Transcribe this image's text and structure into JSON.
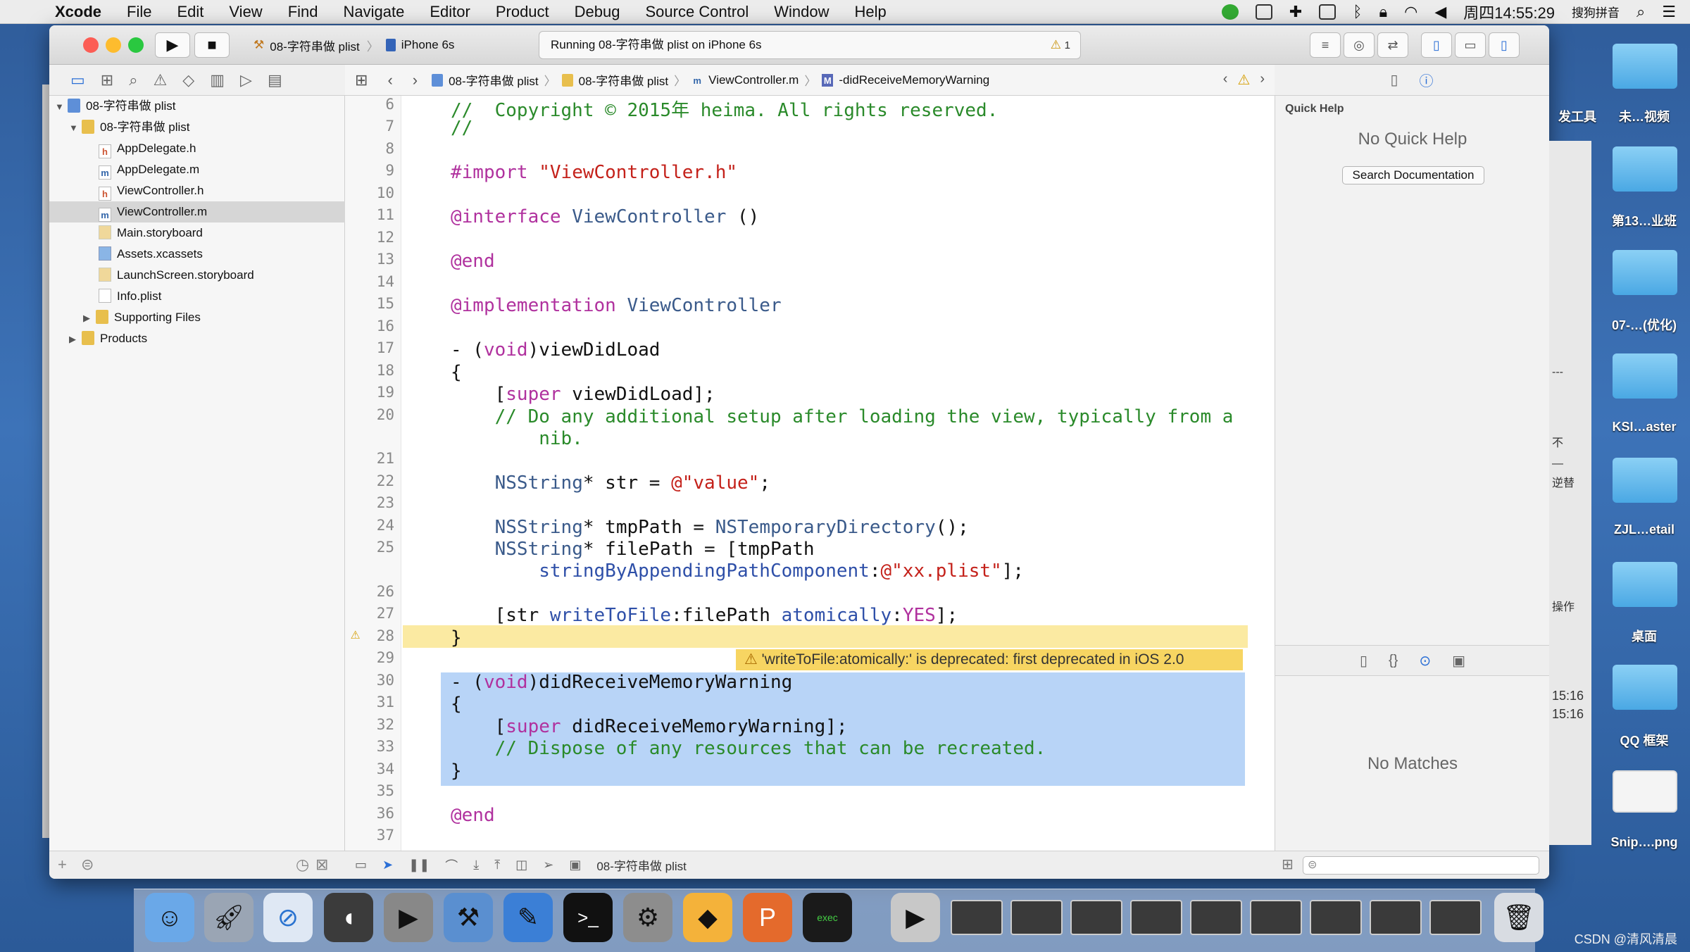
{
  "menubar": {
    "app": "Xcode",
    "items": [
      "File",
      "Edit",
      "View",
      "Find",
      "Navigate",
      "Editor",
      "Product",
      "Debug",
      "Source Control",
      "Window",
      "Help"
    ],
    "clock": "周四14:55:29",
    "ime": "搜狗拼音"
  },
  "toolbar": {
    "scheme": "08-字符串做 plist",
    "device": "iPhone 6s",
    "activity": "Running 08-字符串做 plist on iPhone 6s",
    "warning_count": "1"
  },
  "navigator": {
    "items": [
      {
        "label": "08-字符串做 plist",
        "kind": "proj",
        "icon": "project-icon"
      },
      {
        "label": "08-字符串做 plist",
        "kind": "folder",
        "icon": "folder-icon"
      },
      {
        "label": "AppDelegate.h",
        "kind": "h",
        "icon": "header-file-icon"
      },
      {
        "label": "AppDelegate.m",
        "kind": "m",
        "icon": "source-file-icon"
      },
      {
        "label": "ViewController.h",
        "kind": "h",
        "icon": "header-file-icon"
      },
      {
        "label": "ViewController.m",
        "kind": "m",
        "icon": "source-file-icon"
      },
      {
        "label": "Main.storyboard",
        "kind": "sb",
        "icon": "storyboard-icon"
      },
      {
        "label": "Assets.xcassets",
        "kind": "xc",
        "icon": "assets-icon"
      },
      {
        "label": "LaunchScreen.storyboard",
        "kind": "sb",
        "icon": "storyboard-icon"
      },
      {
        "label": "Info.plist",
        "kind": "pl",
        "icon": "plist-icon"
      },
      {
        "label": "Supporting Files",
        "kind": "folder",
        "icon": "folder-icon"
      },
      {
        "label": "Products",
        "kind": "folder",
        "icon": "folder-icon"
      }
    ]
  },
  "jumpbar": {
    "crumbs": [
      "08-字符串做 plist",
      "08-字符串做 plist",
      "ViewController.m",
      "-didReceiveMemoryWarning"
    ]
  },
  "editor": {
    "lines": [
      {
        "n": "6",
        "t": "//  Copyright © 2015年 heima. All rights reserved."
      },
      {
        "n": "7",
        "t": "//"
      },
      {
        "n": "8",
        "t": ""
      },
      {
        "n": "9",
        "t": "#import \"ViewController.h\""
      },
      {
        "n": "10",
        "t": ""
      },
      {
        "n": "11",
        "t": "@interface ViewController ()"
      },
      {
        "n": "12",
        "t": ""
      },
      {
        "n": "13",
        "t": "@end"
      },
      {
        "n": "14",
        "t": ""
      },
      {
        "n": "15",
        "t": "@implementation ViewController"
      },
      {
        "n": "16",
        "t": ""
      },
      {
        "n": "17",
        "t": "- (void)viewDidLoad"
      },
      {
        "n": "18",
        "t": "{"
      },
      {
        "n": "19",
        "t": "    [super viewDidLoad];"
      },
      {
        "n": "20",
        "t": "    // Do any additional setup after loading the view, typically from a"
      },
      {
        "n": "",
        "t": "        nib."
      },
      {
        "n": "21",
        "t": ""
      },
      {
        "n": "22",
        "t": "    NSString* str = @\"value\";"
      },
      {
        "n": "23",
        "t": ""
      },
      {
        "n": "24",
        "t": "    NSString* tmpPath = NSTemporaryDirectory();"
      },
      {
        "n": "25",
        "t": "    NSString* filePath = [tmpPath"
      },
      {
        "n": "",
        "t": "        stringByAppendingPathComponent:@\"xx.plist\"];"
      },
      {
        "n": "26",
        "t": ""
      },
      {
        "n": "27",
        "t": "    [str writeToFile:filePath atomically:YES];"
      },
      {
        "n": "28",
        "t": "}"
      },
      {
        "n": "29",
        "t": ""
      },
      {
        "n": "30",
        "t": "- (void)didReceiveMemoryWarning"
      },
      {
        "n": "31",
        "t": "{"
      },
      {
        "n": "32",
        "t": "    [super didReceiveMemoryWarning];"
      },
      {
        "n": "33",
        "t": "    // Dispose of any resources that can be recreated."
      },
      {
        "n": "34",
        "t": "}"
      },
      {
        "n": "35",
        "t": ""
      },
      {
        "n": "36",
        "t": "@end"
      },
      {
        "n": "37",
        "t": ""
      }
    ],
    "warning_message": "'writeToFile:atomically:' is deprecated: first deprecated in iOS 2.0"
  },
  "debugbar": {
    "target": "08-字符串做 plist"
  },
  "inspector": {
    "section": "Quick Help",
    "no_quick_help": "No Quick Help",
    "search_button": "Search Documentation",
    "no_matches": "No Matches"
  },
  "background_text": [
    "---",
    "不",
    "—",
    "逆替",
    "操作",
    "15:16",
    "15:16"
  ],
  "desktop": {
    "labels": [
      "发工具",
      "未…视频",
      "第13…业班",
      "07-…(优化)",
      "KSI…aster",
      "ZJL…etail",
      "桌面",
      "QQ 框架",
      "Snip….png"
    ]
  },
  "watermark": "CSDN @清风清晨",
  "colors": {
    "selection": "#b8d4f7",
    "warning": "#f7d562",
    "keyword": "#b0319e",
    "comment": "#2a8a2a",
    "string": "#c4211a"
  }
}
